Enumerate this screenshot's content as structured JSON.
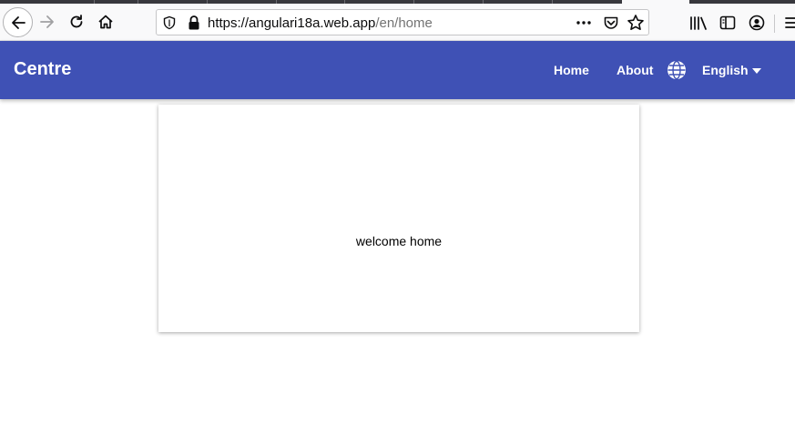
{
  "browser": {
    "url_host": "https://angulari18a.web.app",
    "url_path": "/en/home",
    "icons": [
      "back-icon",
      "forward-icon",
      "reload-icon",
      "home-icon",
      "shield-icon",
      "lock-icon",
      "more-icon",
      "pocket-icon",
      "bookmark-star-icon",
      "library-icon",
      "sidebar-icon",
      "account-icon",
      "menu-icon"
    ]
  },
  "app": {
    "title": "Centre",
    "nav": {
      "home": "Home",
      "about": "About"
    },
    "language": {
      "selected": "English",
      "icon": "globe-icon"
    },
    "colors": {
      "primary": "#3f51b5"
    }
  },
  "content": {
    "message": "welcome home"
  }
}
